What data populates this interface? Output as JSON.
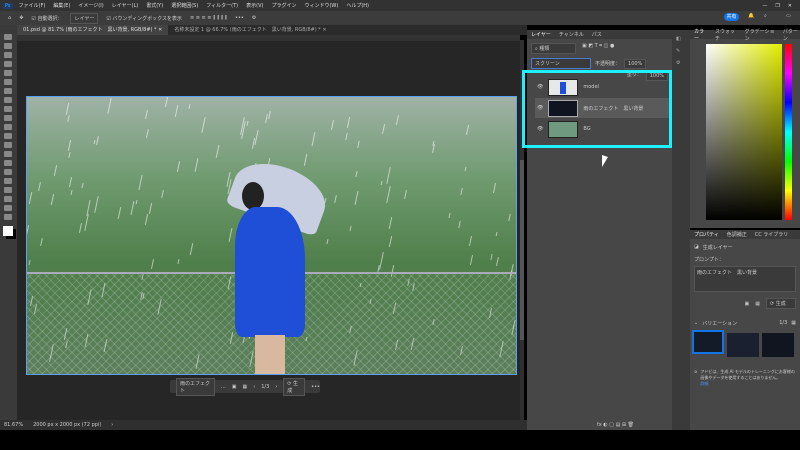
{
  "menu": [
    "ファイル(F)",
    "編集(E)",
    "イメージ(I)",
    "レイヤー(L)",
    "書式(Y)",
    "選択範囲(S)",
    "フィルター(T)",
    "表示(V)",
    "プラグイン",
    "ウィンドウ(W)",
    "ヘルプ(H)"
  ],
  "options": {
    "auto_select": "自動選択：",
    "auto_select_value": "レイヤー",
    "bbox": "バウンディングボックスを表示",
    "share": "共有"
  },
  "tabs": [
    "01.psd @ 81.7% (雨のエフェクト　黒い背景, RGB/8#) *",
    "名称未設定 1 @ 66.7% (雨のエフェクト　黒い背景, RGB/8#) *"
  ],
  "context_bar": {
    "prompt": "雨のエフェクト",
    "counter": "1/3",
    "generate": "生成"
  },
  "status": {
    "zoom": "81.67%",
    "size": "2000 px x 2000 px (72 ppi)"
  },
  "layers_panel": {
    "tabs": [
      "レイヤー",
      "チャンネル",
      "パス"
    ],
    "filter": "種類",
    "blend": "スクリーン",
    "opacity_label": "不透明度：",
    "opacity": "100%",
    "fill_label": "塗り：",
    "fill": "100%",
    "layers": [
      {
        "name": "model",
        "selected": false
      },
      {
        "name": "雨のエフェクト　黒い背景",
        "selected": true
      },
      {
        "name": "BG",
        "selected": false
      }
    ]
  },
  "color_panel": {
    "tabs": [
      "カラー",
      "スウォッチ",
      "グラデーション",
      "パターン"
    ]
  },
  "properties": {
    "tabs": [
      "プロパティ",
      "色調補正",
      "CC ライブラリ"
    ],
    "layer_type": "生成レイヤー",
    "prompt_label": "プロンプト：",
    "prompt": "雨のエフェクト　黒い背景",
    "generate": "生成",
    "variations_label": "バリエーション",
    "variations_count": "1/3",
    "notice": "アドビは、生成 AI モデルのトレーニングにお客様の画像やデータを使用することはありません。",
    "notice_link": "詳細"
  },
  "colors": {
    "highlight": "#1ff0ff",
    "accent": "#1473e6"
  }
}
